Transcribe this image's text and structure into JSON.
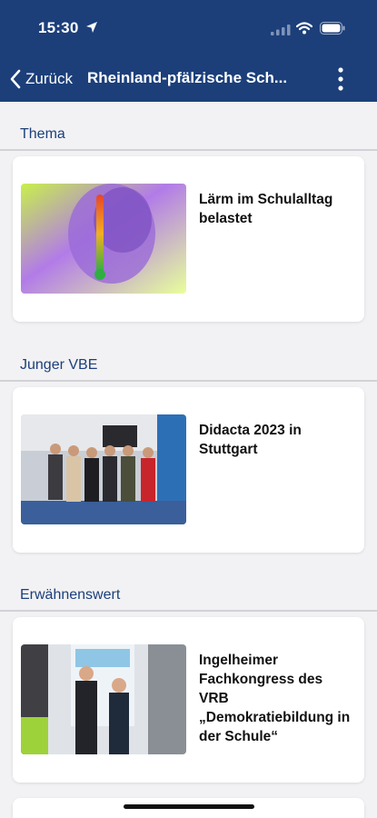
{
  "status_bar": {
    "time": "15:30"
  },
  "nav": {
    "back_label": "Zurück",
    "title": "Rheinland-pfälzische Sch..."
  },
  "sections": [
    {
      "title": "Thema",
      "article": {
        "title": "Lärm im Schulalltag belastet"
      }
    },
    {
      "title": "Junger VBE",
      "article": {
        "title": "Didacta 2023 in Stuttgart"
      }
    },
    {
      "title": "Erwähnenswert",
      "article": {
        "title": "Ingelheimer Fachkongress des VRB „Demokratiebildung in der Schule“"
      }
    }
  ],
  "colors": {
    "header": "#1c3f7a",
    "section_title": "#1c3f7a",
    "background": "#f2f2f4"
  }
}
